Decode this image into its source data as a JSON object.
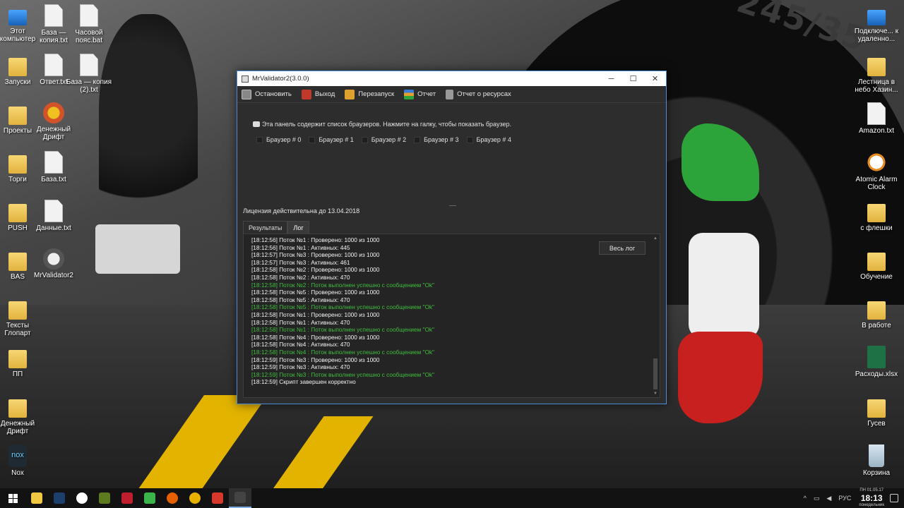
{
  "desktop": {
    "left_icons": [
      {
        "label": "Этот компьютер",
        "icon": "computer-icon"
      },
      {
        "label": "Запуски",
        "icon": "folder-icon"
      },
      {
        "label": "Проекты",
        "icon": "folder-icon"
      },
      {
        "label": "Торги",
        "icon": "folder-icon"
      },
      {
        "label": "PUSH",
        "icon": "folder-icon"
      },
      {
        "label": "BAS",
        "icon": "folder-icon"
      },
      {
        "label": "Тексты Глопарт",
        "icon": "folder-icon"
      },
      {
        "label": "ПП",
        "icon": "folder-icon"
      },
      {
        "label": "Денежный Дрифт",
        "icon": "folder-icon"
      },
      {
        "label": "Nox",
        "icon": "nox-icon"
      }
    ],
    "second_col_icons": [
      {
        "label": "База — копия.txt",
        "icon": "text-file-icon"
      },
      {
        "label": "Ответ.txt",
        "icon": "text-file-icon"
      },
      {
        "label": "Денежный Дрифт",
        "icon": "app-icon"
      },
      {
        "label": "База.txt",
        "icon": "text-file-icon"
      },
      {
        "label": "Данные.txt",
        "icon": "text-file-icon"
      },
      {
        "label": "MrValidator2",
        "icon": "app-icon"
      }
    ],
    "third_col_icons": [
      {
        "label": "Часовой пояс.bat",
        "icon": "settings-file-icon"
      },
      {
        "label": "База — копия (2).txt",
        "icon": "text-file-icon"
      }
    ],
    "right_icons": [
      {
        "label": "Подключе... к удаленно...",
        "icon": "remote-desktop-icon"
      },
      {
        "label": "Лестница в небо Хазин...",
        "icon": "folder-icon"
      },
      {
        "label": "Amazon.txt",
        "icon": "text-file-icon"
      },
      {
        "label": "Atomic Alarm Clock",
        "icon": "alarm-clock-icon"
      },
      {
        "label": "с флешки",
        "icon": "folder-icon"
      },
      {
        "label": "Обучение",
        "icon": "folder-icon"
      },
      {
        "label": "В работе",
        "icon": "folder-icon"
      },
      {
        "label": "Расходы.xlsx",
        "icon": "excel-file-icon"
      },
      {
        "label": "Гусев",
        "icon": "folder-icon"
      },
      {
        "label": "Корзина",
        "icon": "recycle-bin-icon"
      }
    ]
  },
  "window": {
    "title": "MrValidator2(3.0.0)",
    "toolbar": {
      "stop": "Остановить",
      "exit": "Выход",
      "restart": "Перезапуск",
      "report": "Отчет",
      "resources_report": "Отчет о ресурсах"
    },
    "panel_info": "Эта панель содержит список браузеров. Нажмите на галку, чтобы показать браузер.",
    "browsers": [
      "Браузер # 0",
      "Браузер # 1",
      "Браузер # 2",
      "Браузер # 3",
      "Браузер # 4"
    ],
    "license": "Лицензия действительна до 13.04.2018",
    "tabs": {
      "results": "Результаты",
      "log": "Лог"
    },
    "full_log_button": "Весь лог",
    "log": [
      {
        "text": "[18:12:56] Поток №1 : Проверено: 1000 из 1000",
        "ok": false
      },
      {
        "text": "[18:12:56] Поток №1 : Активных: 445",
        "ok": false
      },
      {
        "text": "[18:12:57] Поток №3 : Проверено: 1000 из 1000",
        "ok": false
      },
      {
        "text": "[18:12:57] Поток №3 : Активных: 461",
        "ok": false
      },
      {
        "text": "[18:12:58] Поток №2 : Проверено: 1000 из 1000",
        "ok": false
      },
      {
        "text": "[18:12:58] Поток №2 : Активных: 470",
        "ok": false
      },
      {
        "text": "[18:12:58] Поток №2 : Поток выполнен успешно с сообщением \"Ok\"",
        "ok": true
      },
      {
        "text": "[18:12:58] Поток №5 : Проверено: 1000 из 1000",
        "ok": false
      },
      {
        "text": "[18:12:58] Поток №5 : Активных: 470",
        "ok": false
      },
      {
        "text": "[18:12:58] Поток №5 : Поток выполнен успешно с сообщением \"Ok\"",
        "ok": true
      },
      {
        "text": "[18:12:58] Поток №1 : Проверено: 1000 из 1000",
        "ok": false
      },
      {
        "text": "[18:12:58] Поток №1 : Активных: 470",
        "ok": false
      },
      {
        "text": "[18:12:58] Поток №1 : Поток выполнен успешно с сообщением \"Ok\"",
        "ok": true
      },
      {
        "text": "[18:12:58] Поток №4 : Проверено: 1000 из 1000",
        "ok": false
      },
      {
        "text": "[18:12:58] Поток №4 : Активных: 470",
        "ok": false
      },
      {
        "text": "[18:12:58] Поток №4 : Поток выполнен успешно с сообщением \"Ok\"",
        "ok": true
      },
      {
        "text": "[18:12:59] Поток №3 : Проверено: 1000 из 1000",
        "ok": false
      },
      {
        "text": "[18:12:59] Поток №3 : Активных: 470",
        "ok": false
      },
      {
        "text": "[18:12:59] Поток №3 : Поток выполнен успешно с сообщением \"Ok\"",
        "ok": true
      },
      {
        "text": "[18:12:59] Скрипт завершен корректно",
        "ok": false
      }
    ]
  },
  "taskbar": {
    "apps": [
      "file-explorer-icon",
      "photoshop-icon",
      "yandex-browser-icon",
      "muse-icon",
      "filezilla-icon",
      "camtasia-icon",
      "firefox-icon",
      "chrome-icon",
      "camtasia-recorder-icon",
      "mrvalidator-icon"
    ],
    "language": "РУС",
    "time": "18:13",
    "date": "ПН 01.05.17",
    "day": "понедельник"
  },
  "colors": {
    "accent": "#4a90d9",
    "ok_log": "#3fbf3f",
    "window_bg": "#2d2d2d"
  }
}
